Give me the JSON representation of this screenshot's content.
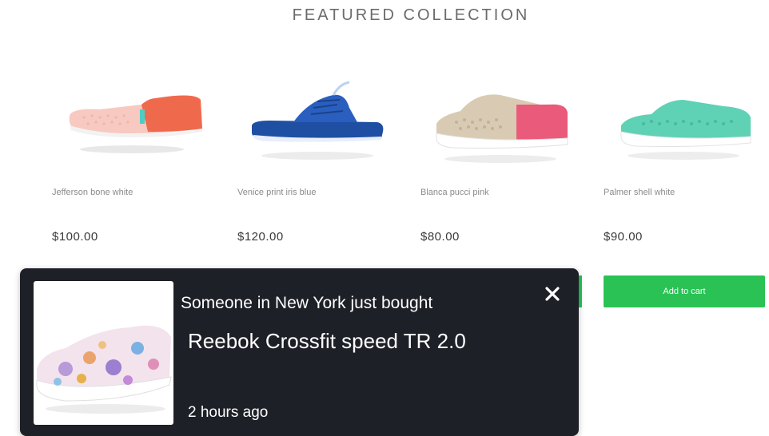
{
  "section": {
    "title": "FEATURED COLLECTION"
  },
  "products": [
    {
      "name": "Jefferson bone  white",
      "price": "$100.00",
      "image_icon": "slip-on-shoe-pink-orange"
    },
    {
      "name": "Venice print iris blue",
      "price": "$120.00",
      "image_icon": "slide-sandal-blue"
    },
    {
      "name": "Blanca pucci pink",
      "price": "$80.00",
      "image_icon": "perforated-shoe-beige-pink"
    },
    {
      "name": "Palmer shell white",
      "price": "$90.00",
      "image_icon": "perforated-shoe-mint",
      "button_label": "Add to cart"
    }
  ],
  "notification": {
    "intro": "Someone in New York just bought",
    "product": "Reebok Crossfit speed TR 2.0",
    "time": "2 hours ago",
    "image_icon": "floral-slip-on-shoe"
  },
  "colors": {
    "accent_green": "#2ac254",
    "popup_background": "#1e2027"
  }
}
